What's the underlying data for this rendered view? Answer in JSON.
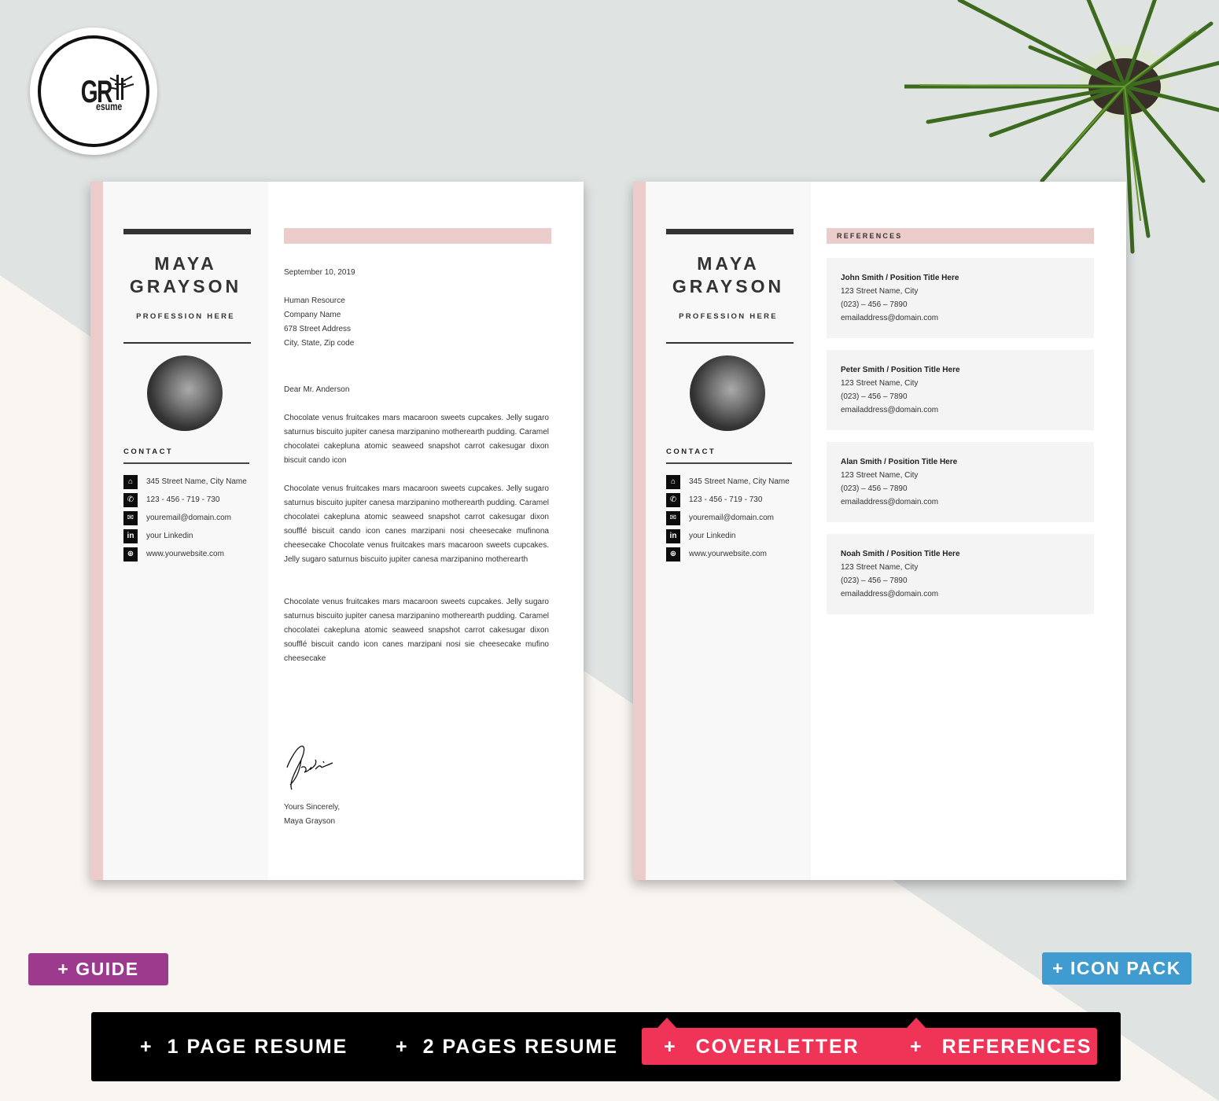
{
  "brand": {
    "logo_text_main": "GR",
    "logo_text_sub": "esume"
  },
  "colors": {
    "accent_pink": "#ebcccb",
    "guide_purple": "#9c3b8e",
    "iconpack_blue": "#3f9bd0",
    "highlight_red": "#ef3458",
    "bar_black": "#000000"
  },
  "resume": {
    "first_name": "MAYA",
    "last_name": "GRAYSON",
    "profession": "PROFESSION HERE",
    "contact_title": "CONTACT",
    "contacts": [
      {
        "icon": "home-icon",
        "glyph": "⌂",
        "text": "345 Street Name, City Name"
      },
      {
        "icon": "phone-icon",
        "glyph": "✆",
        "text": "123 - 456 - 719 - 730"
      },
      {
        "icon": "mail-icon",
        "glyph": "✉",
        "text": "youremail@domain.com"
      },
      {
        "icon": "linkedin-icon",
        "glyph": "in",
        "text": "your Linkedin"
      },
      {
        "icon": "globe-icon",
        "glyph": "⊕",
        "text": "www.yourwebsite.com"
      }
    ]
  },
  "cover_letter": {
    "date": "September 10, 2019",
    "recipient": [
      "Human Resource",
      "Company Name",
      "678 Street Address",
      "City, State, Zip code"
    ],
    "greeting": "Dear Mr. Anderson",
    "paragraphs": [
      "Chocolate venus fruitcakes mars macaroon sweets cupcakes. Jelly sugaro saturnus biscuito jupiter canesa marzipanino motherearth pudding. Caramel chocolatei cakepluna atomic seaweed snapshot carrot cakesugar dixon biscuit cando icon",
      "Chocolate venus fruitcakes mars macaroon sweets cupcakes. Jelly sugaro saturnus biscuito jupiter canesa marzipanino motherearth pudding. Caramel chocolatei cakepluna atomic seaweed snapshot carrot cakesugar dixon soufflé biscuit cando icon canes marzipani nosi cheesecake mufinona cheesecake Chocolate venus fruitcakes mars macaroon sweets cupcakes. Jelly sugaro saturnus biscuito jupiter canesa marzipanino motherearth",
      "Chocolate venus fruitcakes mars macaroon sweets cupcakes. Jelly sugaro saturnus biscuito jupiter canesa marzipanino motherearth pudding. Caramel chocolatei cakepluna atomic seaweed snapshot carrot cakesugar dixon soufflé biscuit cando icon canes marzipani nosi sie cheesecake mufino cheesecake"
    ],
    "closing": "Yours Sincerely,",
    "signer": "Maya Grayson"
  },
  "references": {
    "title": "REFERENCES",
    "items": [
      {
        "name": "John Smith / Position Title Here",
        "address": "123 Street Name, City",
        "phone": "(023) – 456 – 7890",
        "email": "emailaddress@domain.com"
      },
      {
        "name": "Peter Smith / Position Title Here",
        "address": "123 Street Name, City",
        "phone": "(023) – 456 – 7890",
        "email": "emailaddress@domain.com"
      },
      {
        "name": "Alan Smith / Position Title Here",
        "address": "123 Street Name, City",
        "phone": "(023) – 456 – 7890",
        "email": "emailaddress@domain.com"
      },
      {
        "name": "Noah Smith / Position Title Here",
        "address": "123 Street Name, City",
        "phone": "(023) – 456 – 7890",
        "email": "emailaddress@domain.com"
      }
    ]
  },
  "badges": {
    "guide": "+ GUIDE",
    "icon_pack": "+ ICON PACK"
  },
  "features": [
    {
      "plus": "+",
      "label": "1 PAGE RESUME"
    },
    {
      "plus": "+",
      "label": "2 PAGES RESUME"
    },
    {
      "plus": "+",
      "label": "COVERLETTER"
    },
    {
      "plus": "+",
      "label": "REFERENCES"
    }
  ]
}
